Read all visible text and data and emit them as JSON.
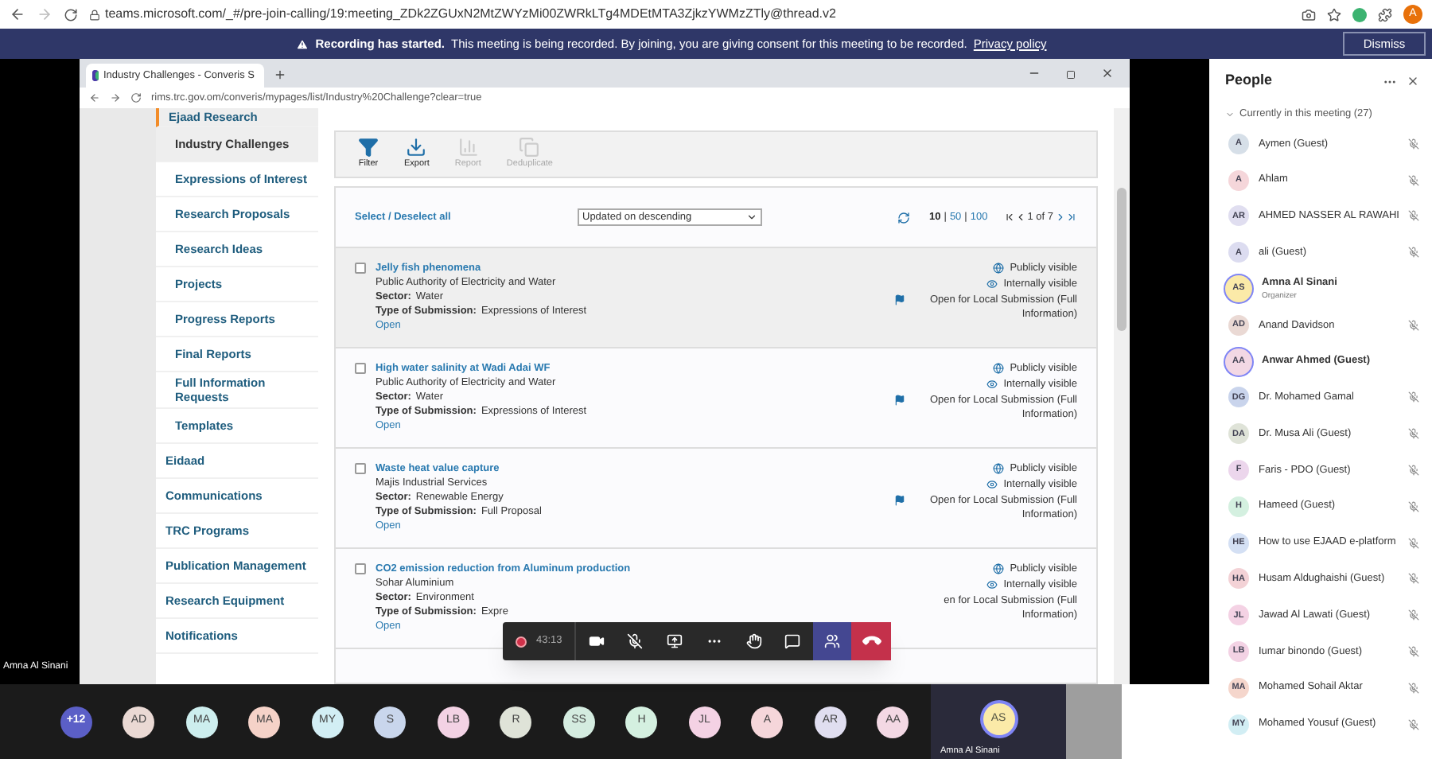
{
  "browser": {
    "url": "teams.microsoft.com/_#/pre-join-calling/19:meeting_ZDk2ZGUxN2MtZWYzMi00ZWRkLTg4MDEtMTA3ZjkzYWMzZTly@thread.v2",
    "profile_initial": "A"
  },
  "banner": {
    "title": "Recording has started.",
    "message": "This meeting is being recorded. By joining, you are giving consent for this meeting to be recorded.",
    "link": "Privacy policy",
    "button": "Dismiss"
  },
  "shared_screen": {
    "presenter_label": "Amna Al Sinani",
    "window": {
      "tab_title": "Industry Challenges - Converis S",
      "url": "rims.trc.gov.om/converis/mypages/list/Industry%20Challenge?clear=true",
      "sidebar": {
        "items": [
          {
            "label": "Ejaad Research",
            "selected": true,
            "children": [
              {
                "label": "Industry Challenges",
                "selected": true
              },
              {
                "label": "Expressions of Interest",
                "selected": false
              },
              {
                "label": "Research Proposals",
                "selected": false
              },
              {
                "label": "Research Ideas",
                "selected": false
              },
              {
                "label": "Projects",
                "selected": false
              },
              {
                "label": "Progress Reports",
                "selected": false
              },
              {
                "label": "Final Reports",
                "selected": false
              },
              {
                "label": "Full Information Requests",
                "selected": false
              },
              {
                "label": "Templates",
                "selected": false
              }
            ]
          },
          {
            "label": "Eidaad",
            "selected": false
          },
          {
            "label": "Communications",
            "selected": false
          },
          {
            "label": "TRC Programs",
            "selected": false
          },
          {
            "label": "Publication Management",
            "selected": false
          },
          {
            "label": "Research Equipment",
            "selected": false
          },
          {
            "label": "Notifications",
            "selected": false
          }
        ]
      },
      "toolbar": [
        {
          "kind": "filter",
          "label": "Filter",
          "disabled": false
        },
        {
          "kind": "export",
          "label": "Export",
          "disabled": false
        },
        {
          "kind": "report",
          "label": "Report",
          "disabled": true
        },
        {
          "kind": "deduplicate",
          "label": "Deduplicate",
          "disabled": true
        }
      ],
      "list_header": {
        "select_all": "Select / Deselect all",
        "sort": "Updated on descending",
        "page_sizes": [
          {
            "label": "10",
            "selected": true
          },
          {
            "label": "50",
            "selected": false
          },
          {
            "label": "100",
            "selected": false
          }
        ],
        "separators": [
          "|",
          "|"
        ],
        "pager": "1 of 7"
      },
      "items": [
        {
          "title": "Jelly fish phenomena",
          "organization": "Public Authority of Electricity and Water",
          "sector_label": "Sector:",
          "sector": "Water",
          "type_label": "Type of Submission:",
          "type": "Expressions of Interest",
          "link": "Open",
          "checked": false,
          "highlighted": true,
          "statuses": [
            {
              "kind": "globe",
              "label": "Publicly visible"
            },
            {
              "kind": "eye",
              "label": "Internally visible"
            },
            {
              "kind": "flag",
              "label": "Open for Local Submission (Full Information)"
            }
          ]
        },
        {
          "title": "High water salinity at Wadi Adai WF",
          "organization": "Public Authority of Electricity and Water",
          "sector_label": "Sector:",
          "sector": "Water",
          "type_label": "Type of Submission:",
          "type": "Expressions of Interest",
          "link": "Open",
          "checked": false,
          "highlighted": false,
          "statuses": [
            {
              "kind": "globe",
              "label": "Publicly visible"
            },
            {
              "kind": "eye",
              "label": "Internally visible"
            },
            {
              "kind": "flag",
              "label": "Open for Local Submission (Full Information)"
            }
          ]
        },
        {
          "title": "Waste heat value capture",
          "organization": "Majis Industrial Services",
          "sector_label": "Sector:",
          "sector": "Renewable Energy",
          "type_label": "Type of Submission:",
          "type": "Full Proposal",
          "link": "Open",
          "checked": false,
          "highlighted": false,
          "statuses": [
            {
              "kind": "globe",
              "label": "Publicly visible"
            },
            {
              "kind": "eye",
              "label": "Internally visible"
            },
            {
              "kind": "flag",
              "label": "Open for Local Submission (Full Information)"
            }
          ]
        },
        {
          "title": "CO2 emission reduction from Aluminum production",
          "organization": "Sohar Aluminium",
          "sector_label": "Sector:",
          "sector": "Environment",
          "type_label": "Type of Submission:",
          "type": "Expre",
          "link": "Open",
          "checked": false,
          "highlighted": false,
          "statuses": [
            {
              "kind": "globe",
              "label": "Publicly visible"
            },
            {
              "kind": "eye",
              "label": "Internally visible"
            },
            {
              "kind": "plain",
              "label": "en for Local Submission (Full Information)"
            }
          ]
        }
      ]
    }
  },
  "call_controls": {
    "timer": "43:13",
    "buttons": [
      {
        "kind": "camera",
        "selected": false
      },
      {
        "kind": "mic-off",
        "selected": false
      },
      {
        "kind": "share",
        "selected": false
      },
      {
        "kind": "more",
        "selected": false
      },
      {
        "kind": "hand",
        "selected": false
      },
      {
        "kind": "chat",
        "selected": false
      },
      {
        "kind": "people",
        "selected": true
      },
      {
        "kind": "hangup",
        "selected": false
      }
    ]
  },
  "gallery": {
    "overflow": "+12",
    "avatars": [
      {
        "initials": "AD",
        "color": "#ead9d4"
      },
      {
        "initials": "MA",
        "color": "#cdeeee"
      },
      {
        "initials": "MA",
        "color": "#f5d2c8"
      },
      {
        "initials": "MY",
        "color": "#d2eef4"
      },
      {
        "initials": "S",
        "color": "#c9d6ec"
      },
      {
        "initials": "LB",
        "color": "#f3d2e4"
      },
      {
        "initials": "R",
        "color": "#dfe3d8"
      },
      {
        "initials": "SS",
        "color": "#d4ece0"
      },
      {
        "initials": "H",
        "color": "#d4f0e0"
      },
      {
        "initials": "JL",
        "color": "#f4d2e4"
      },
      {
        "initials": "A",
        "color": "#f5d6da"
      },
      {
        "initials": "AR",
        "color": "#e0def0"
      },
      {
        "initials": "AA",
        "color": "#f3d8e4"
      }
    ],
    "active": {
      "initials": "AS",
      "name": "Amna Al Sinani",
      "color": "#fbeaa8"
    }
  },
  "people": {
    "title": "People",
    "section": "Currently in this meeting (27)",
    "expanded": true,
    "participants": [
      {
        "initials": "A",
        "name": "Aymen (Guest)",
        "color": "#d6dfe8",
        "muted": true
      },
      {
        "initials": "A",
        "name": "Ahlam",
        "color": "#f5d6da",
        "muted": true
      },
      {
        "initials": "AR",
        "name": "AHMED NASSER AL RAWAHI",
        "color": "#e0def0",
        "muted": true
      },
      {
        "initials": "A",
        "name": "ali (Guest)",
        "color": "#dcdcf0",
        "muted": true
      },
      {
        "initials": "AS",
        "name": "Amna Al Sinani",
        "role": "Organizer",
        "color": "#fbeaa8",
        "muted": false
      },
      {
        "initials": "AD",
        "name": "Anand Davidson",
        "color": "#ead9d4",
        "muted": true
      },
      {
        "initials": "AA",
        "name": "Anwar Ahmed (Guest)",
        "color": "#f3d8e4",
        "muted": false
      },
      {
        "initials": "DG",
        "name": "Dr. Mohamed Gamal",
        "color": "#c9d4ec",
        "muted": true
      },
      {
        "initials": "DA",
        "name": "Dr. Musa Ali (Guest)",
        "color": "#dfe3d8",
        "muted": true
      },
      {
        "initials": "F",
        "name": "Faris - PDO (Guest)",
        "color": "#ecd6ec",
        "muted": true
      },
      {
        "initials": "H",
        "name": "Hameed (Guest)",
        "color": "#d4f0e0",
        "muted": true
      },
      {
        "initials": "HE",
        "name": "How to use EJAAD e-platform",
        "color": "#d4e0f4",
        "muted": true
      },
      {
        "initials": "HA",
        "name": "Husam Aldughaishi (Guest)",
        "color": "#f3d2d6",
        "muted": true
      },
      {
        "initials": "JL",
        "name": "Jawad Al Lawati (Guest)",
        "color": "#f4d2e4",
        "muted": true
      },
      {
        "initials": "LB",
        "name": "Iumar binondo (Guest)",
        "color": "#f3d2e4",
        "muted": true
      },
      {
        "initials": "MA",
        "name": "Mohamed Sohail Aktar",
        "color": "#f5d6cc",
        "muted": true
      },
      {
        "initials": "MY",
        "name": "Mohamed Yousuf (Guest)",
        "color": "#d2eef4",
        "muted": true
      }
    ]
  }
}
